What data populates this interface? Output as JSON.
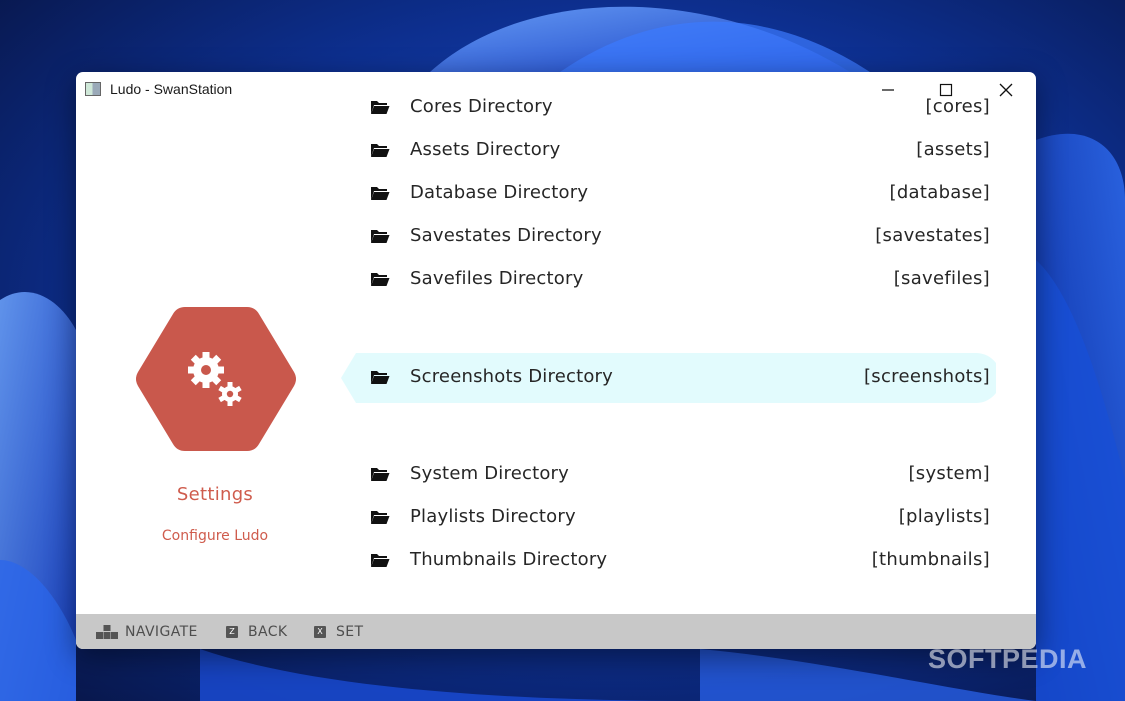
{
  "window": {
    "title": "Ludo - SwanStation"
  },
  "category": {
    "title": "Settings",
    "subtitle": "Configure Ludo",
    "icon": "gears-icon",
    "color": "#c9584c"
  },
  "list": {
    "items": [
      {
        "label": "Cores Directory",
        "value": "[cores]"
      },
      {
        "label": "Assets Directory",
        "value": "[assets]"
      },
      {
        "label": "Database Directory",
        "value": "[database]"
      },
      {
        "label": "Savestates Directory",
        "value": "[savestates]"
      },
      {
        "label": "Savefiles Directory",
        "value": "[savefiles]"
      },
      {
        "label": "Screenshots Directory",
        "value": "[screenshots]",
        "selected": true
      },
      {
        "label": "System Directory",
        "value": "[system]"
      },
      {
        "label": "Playlists Directory",
        "value": "[playlists]"
      },
      {
        "label": "Thumbnails Directory",
        "value": "[thumbnails]"
      }
    ],
    "highlight_color": "#e2fbfd"
  },
  "hints": {
    "navigate": {
      "label": "NAVIGATE",
      "icon": "dpad-icon"
    },
    "back": {
      "label": "BACK",
      "key": "Z"
    },
    "set": {
      "label": "SET",
      "key": "X"
    }
  },
  "watermark": "SOFTPEDIA"
}
